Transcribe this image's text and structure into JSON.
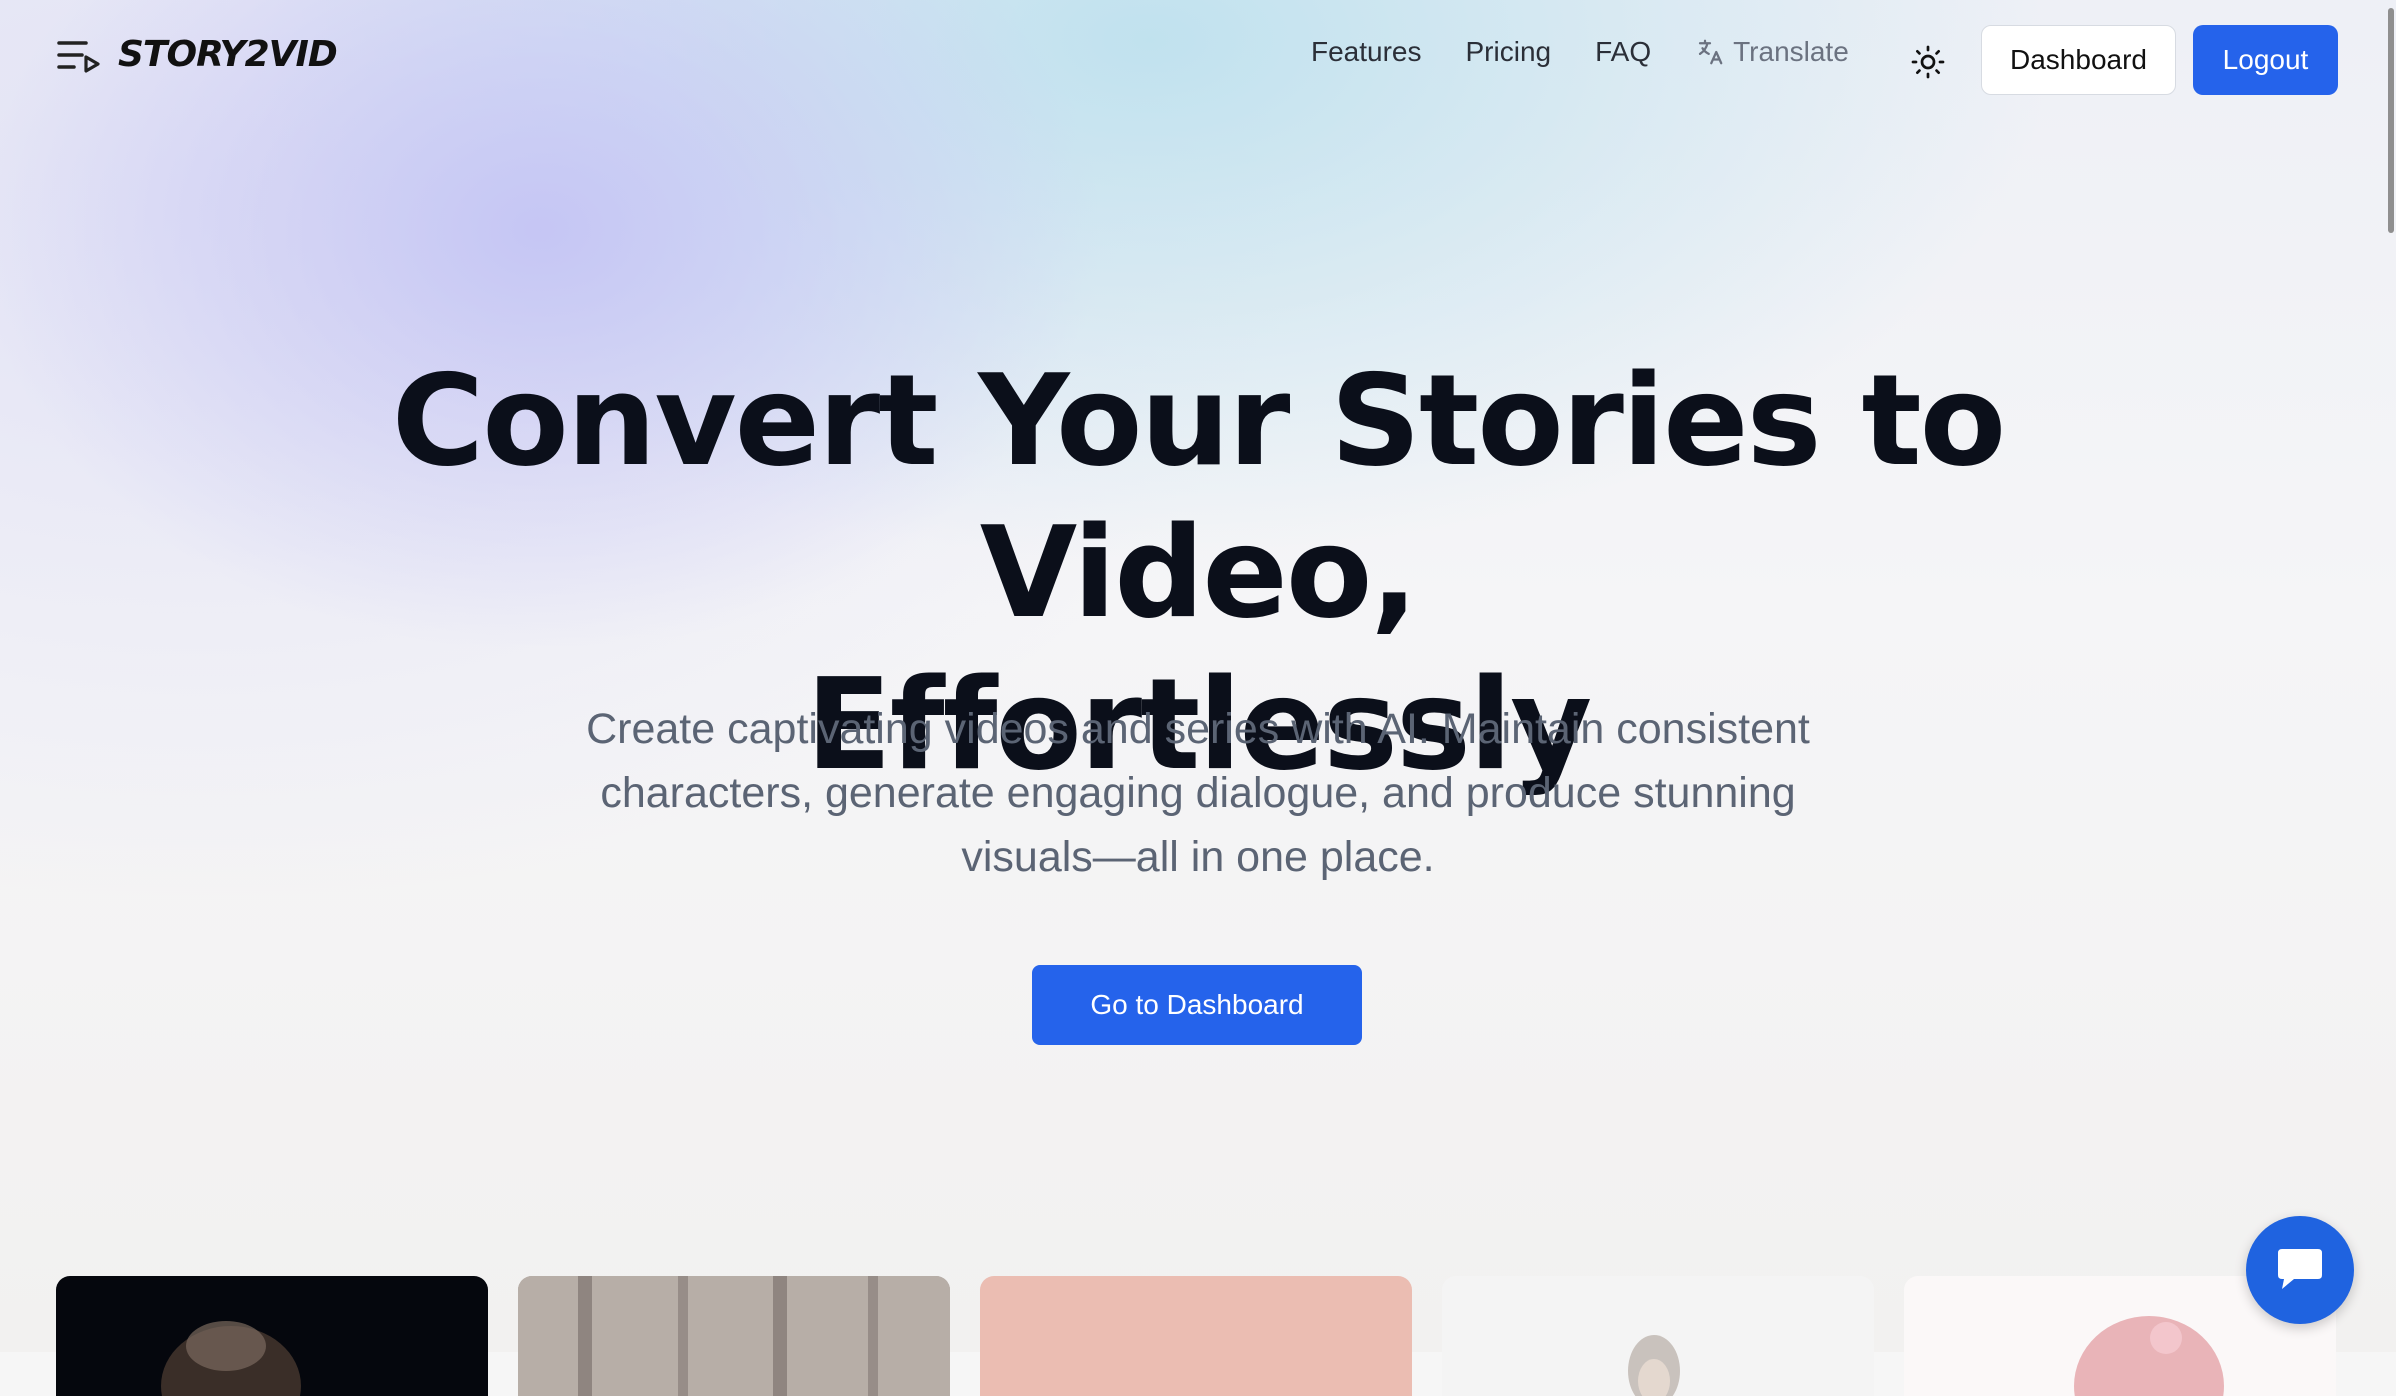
{
  "brand": {
    "name": "STORY2VID"
  },
  "nav": {
    "links": [
      "Features",
      "Pricing",
      "FAQ"
    ],
    "translate_label": "Translate",
    "dashboard_label": "Dashboard",
    "logout_label": "Logout"
  },
  "hero": {
    "title_line1": "Convert Your Stories to Video,",
    "title_line2": "Effortlessly",
    "subtitle": "Create captivating videos and series with AI. Maintain consistent characters, generate engaging dialogue, and produce stunning visuals—all in one place.",
    "cta_label": "Go to Dashboard"
  },
  "colors": {
    "accent": "#2563eb",
    "title": "#0b0f1a",
    "subtitle": "#5b6474"
  },
  "icons": {
    "logo": "list-play-icon",
    "translate": "translate-icon",
    "theme": "sun-icon",
    "chat": "chat-icon"
  },
  "cards": [
    {
      "name": "card-dark-creature",
      "color": "#05070d"
    },
    {
      "name": "card-curtains",
      "color": "#a79e98"
    },
    {
      "name": "card-pink",
      "color": "#ebbdb2"
    },
    {
      "name": "card-portrait",
      "color": "#f4f4f4"
    },
    {
      "name": "card-anime-girl",
      "color": "#fbf8f8"
    }
  ]
}
